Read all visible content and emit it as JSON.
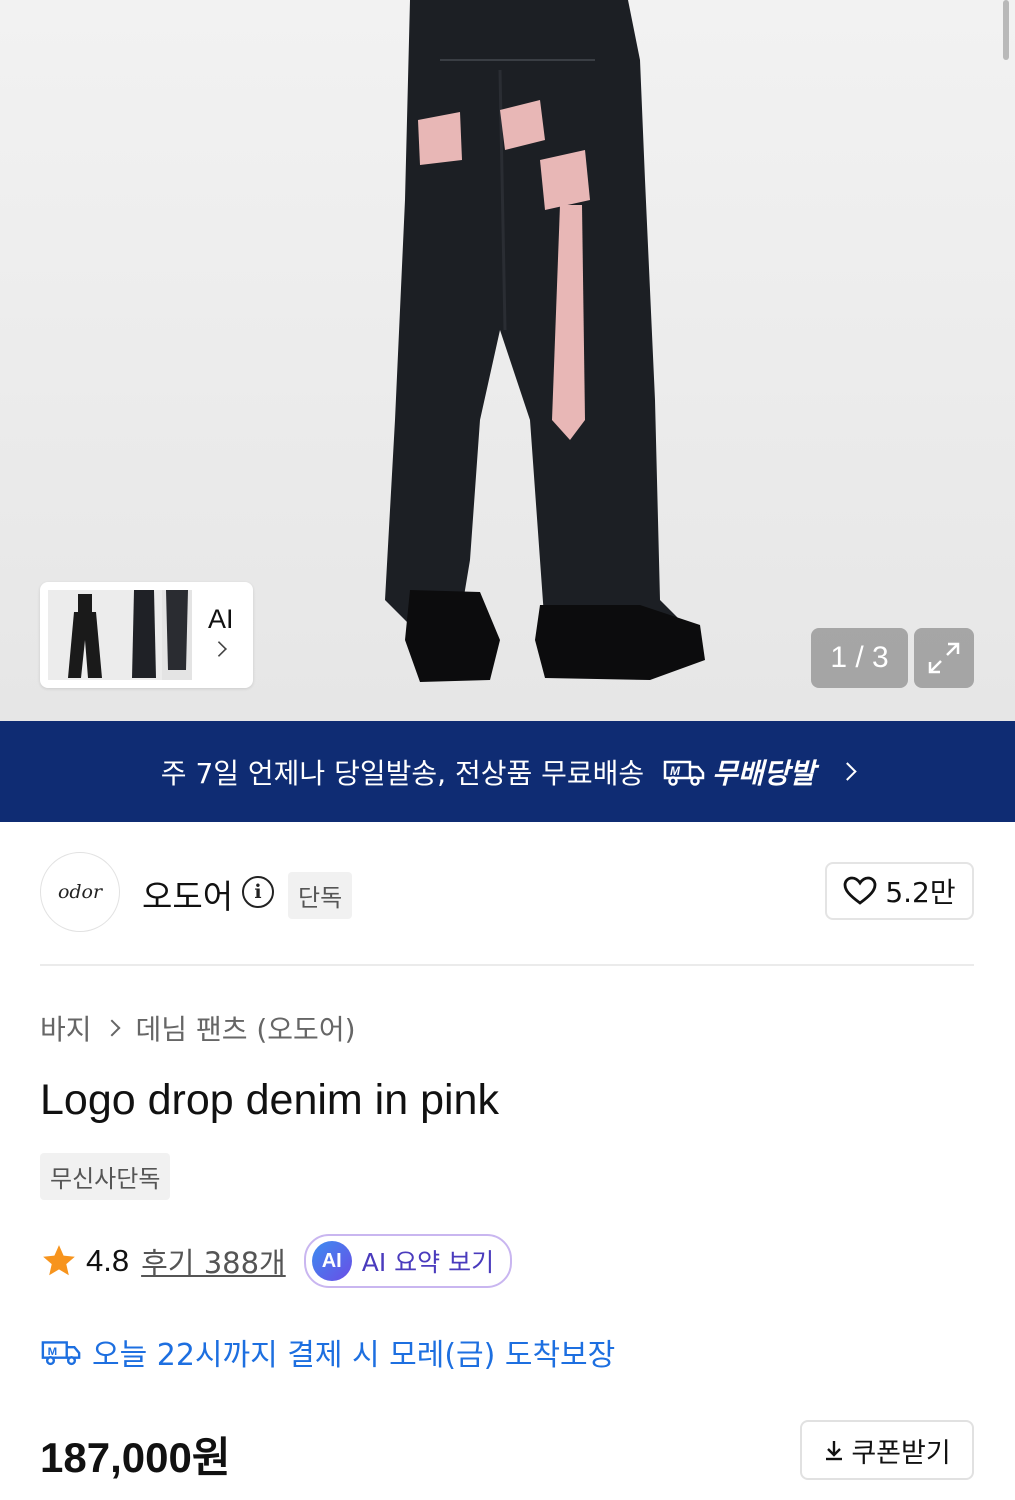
{
  "gallery": {
    "thumb_ai_label": "AI",
    "counter": "1 / 3"
  },
  "banner": {
    "message": "주 7일 언제나 당일발송, 전상품 무료배송",
    "badge_label": "무배당발"
  },
  "brand": {
    "logo_text": "odor",
    "name": "오도어",
    "tag": "단독",
    "likes": "5.2만"
  },
  "breadcrumb": {
    "category": "바지",
    "subcategory": "데님 팬츠 (오도어)"
  },
  "product": {
    "title": "Logo drop denim in pink",
    "exclusive_badge": "무신사단독",
    "rating": "4.8",
    "reviews": "후기 388개",
    "ai_summary_label": "AI 요약 보기",
    "ai_icon_text": "AI",
    "delivery_notice": "오늘 22시까지 결제 시 모레(금) 도착보장",
    "price": "187,000원",
    "coupon_label": "쿠폰받기"
  },
  "colors": {
    "banner_bg": "#0f2c73",
    "delivery_blue": "#1d6fe0",
    "star": "#f7941d",
    "ai_purple": "#4a3bbd"
  }
}
